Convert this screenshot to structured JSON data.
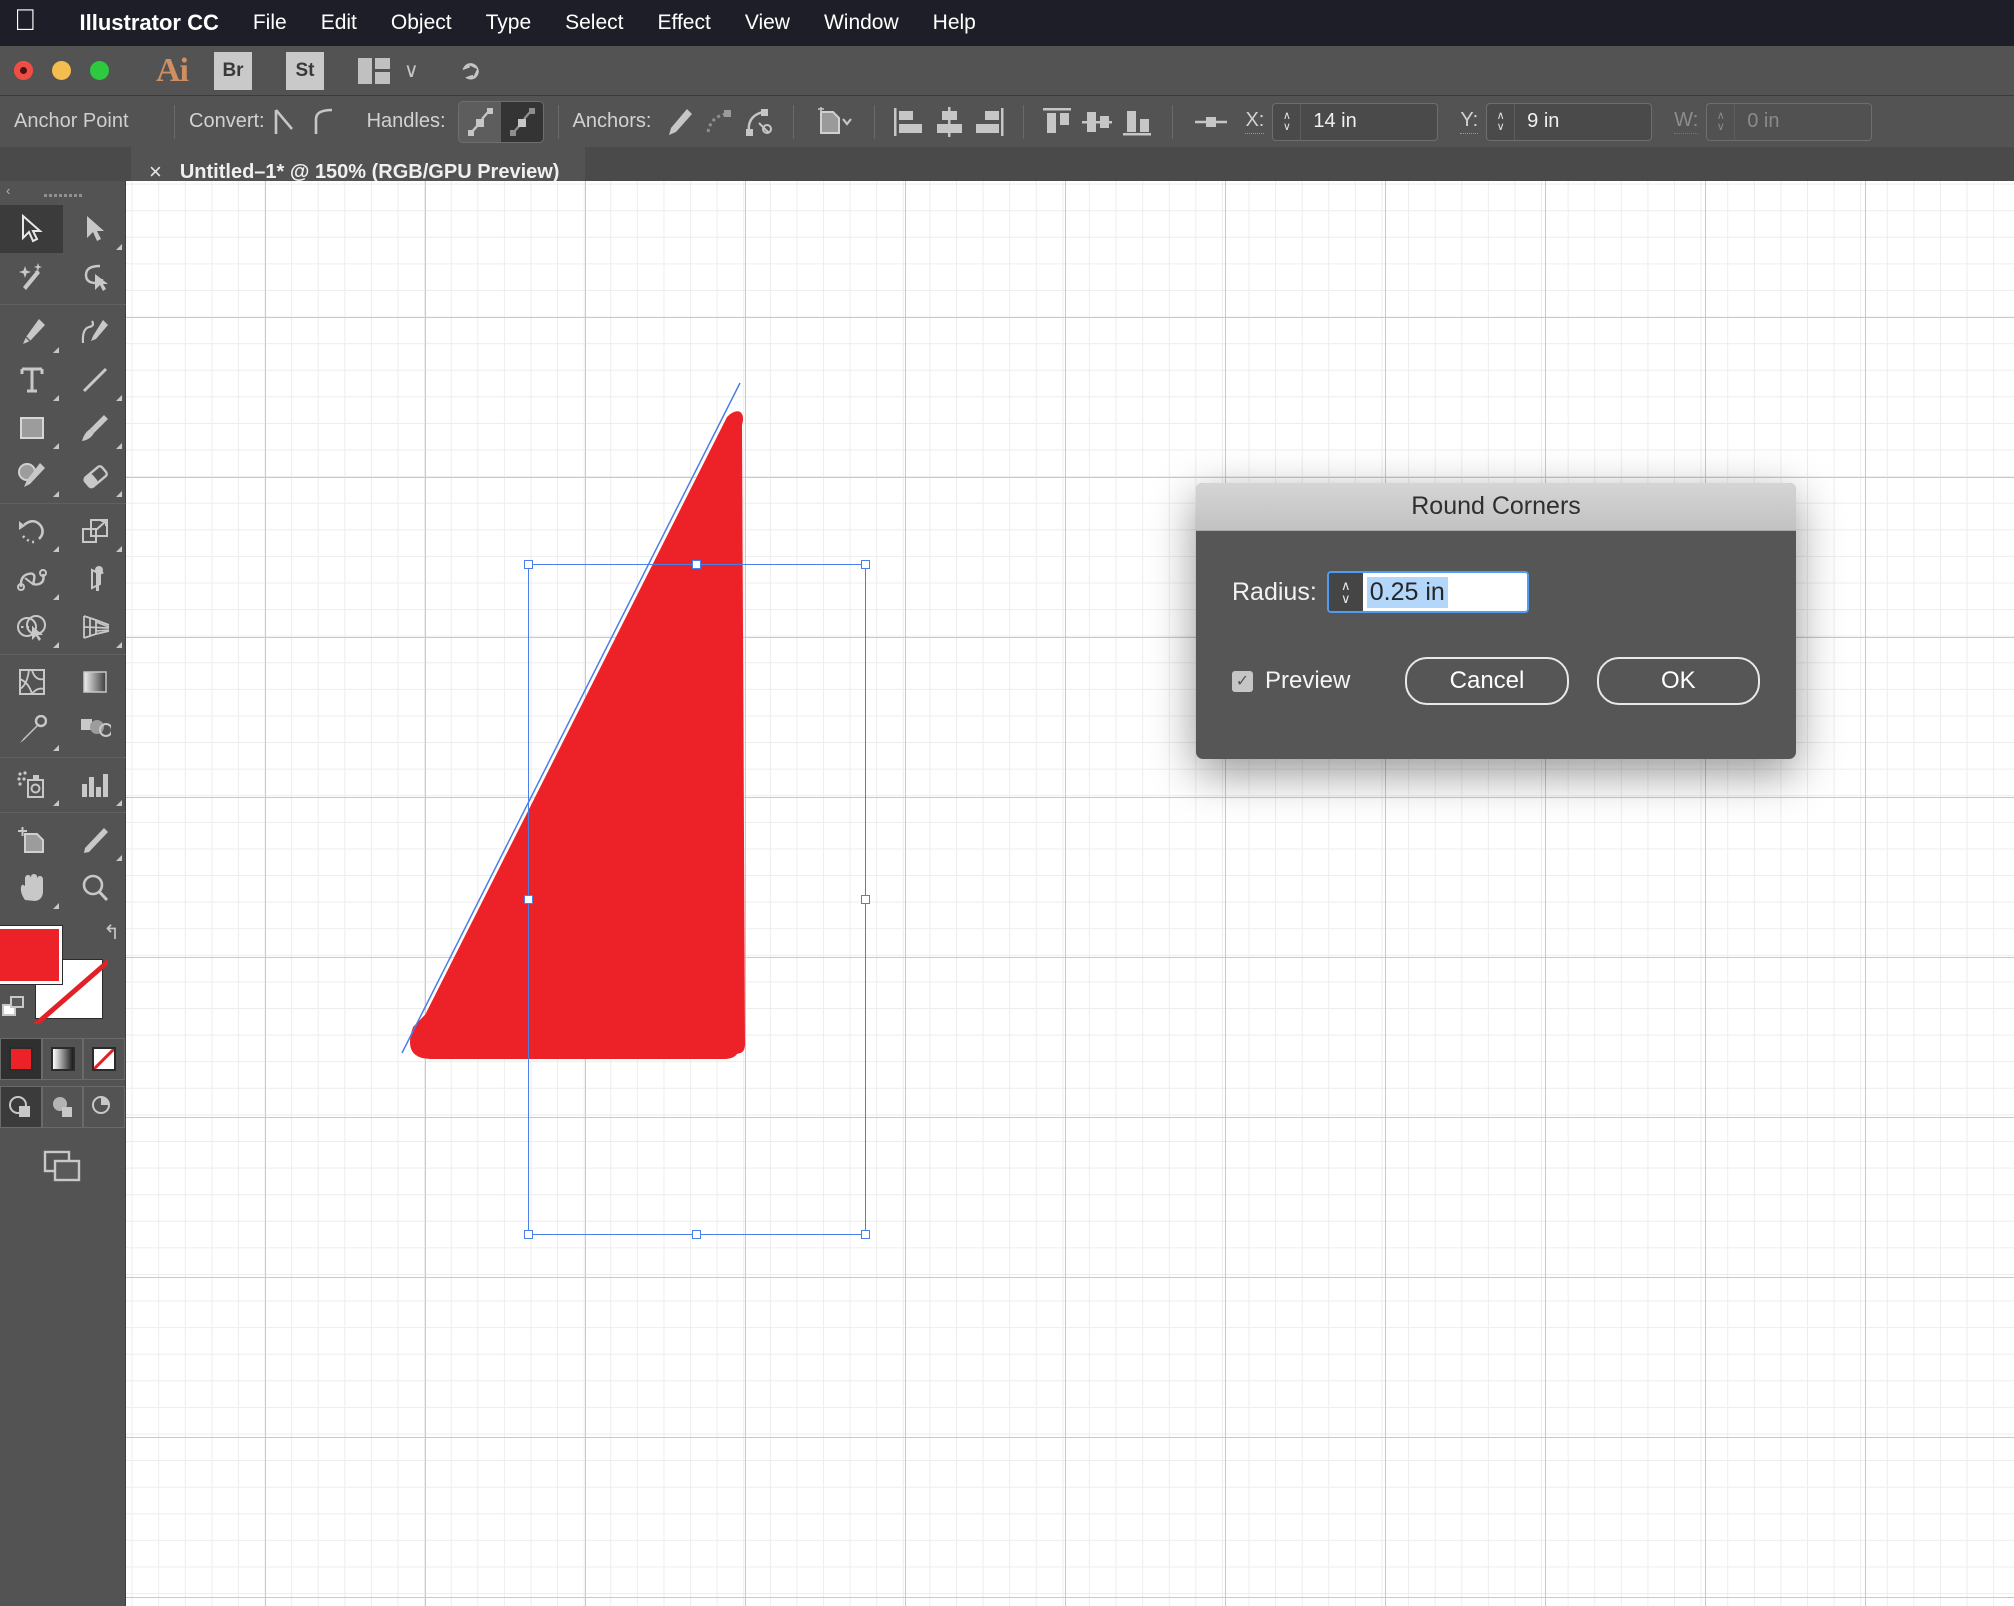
{
  "menubar": {
    "apple_icon": "apple-logo",
    "items": [
      {
        "label": "Illustrator CC",
        "bold": true
      },
      {
        "label": "File",
        "bold": false
      },
      {
        "label": "Edit",
        "bold": false
      },
      {
        "label": "Object",
        "bold": false
      },
      {
        "label": "Type",
        "bold": false
      },
      {
        "label": "Select",
        "bold": false
      },
      {
        "label": "Effect",
        "bold": false
      },
      {
        "label": "View",
        "bold": false
      },
      {
        "label": "Window",
        "bold": false
      },
      {
        "label": "Help",
        "bold": false
      }
    ]
  },
  "apptoolbar": {
    "app_logo": "Ai",
    "bridge_label": "Br",
    "stock_label": "St",
    "workspace_icon": "workspace-switcher-icon",
    "chevron": "∨",
    "rocket_icon": "rocket-icon"
  },
  "controlbar": {
    "context_label": "Anchor Point",
    "convert_label": "Convert:",
    "handles_label": "Handles:",
    "anchors_label": "Anchors:",
    "x_label": "X:",
    "x_value": "14 in",
    "y_label": "Y:",
    "y_value": "9 in",
    "w_label": "W:",
    "w_value": "0 in",
    "stepper_up": "∧",
    "stepper_down": "∨"
  },
  "tabbar": {
    "close_glyph": "×",
    "title": "Untitled–1* @ 150% (RGB/GPU Preview)"
  },
  "toolpanel": {
    "collapse_glyph": "‹",
    "tools": [
      {
        "name": "selection-tool",
        "active": true
      },
      {
        "name": "direct-selection-tool",
        "active": false
      },
      {
        "name": "magic-wand-tool",
        "active": false
      },
      {
        "name": "lasso-tool",
        "active": false
      },
      {
        "name": "pen-tool",
        "active": false
      },
      {
        "name": "curvature-tool",
        "active": false
      },
      {
        "name": "type-tool",
        "active": false
      },
      {
        "name": "line-segment-tool",
        "active": false
      },
      {
        "name": "rectangle-tool",
        "active": false
      },
      {
        "name": "paintbrush-tool",
        "active": false
      },
      {
        "name": "shaper-pencil-tool",
        "active": false
      },
      {
        "name": "eraser-tool",
        "active": false
      },
      {
        "name": "rotate-tool",
        "active": false
      },
      {
        "name": "scale-tool",
        "active": false
      },
      {
        "name": "width-tool",
        "active": false
      },
      {
        "name": "free-transform-tool",
        "active": false
      },
      {
        "name": "shape-builder-tool",
        "active": false
      },
      {
        "name": "perspective-grid-tool",
        "active": false
      },
      {
        "name": "mesh-tool",
        "active": false
      },
      {
        "name": "gradient-tool",
        "active": false
      },
      {
        "name": "eyedropper-tool",
        "active": false
      },
      {
        "name": "blend-tool",
        "active": false
      },
      {
        "name": "symbol-sprayer-tool",
        "active": false
      },
      {
        "name": "column-graph-tool",
        "active": false
      },
      {
        "name": "artboard-tool",
        "active": false
      },
      {
        "name": "slice-tool",
        "active": false
      },
      {
        "name": "hand-tool",
        "active": false
      },
      {
        "name": "zoom-tool",
        "active": false
      }
    ],
    "fill_color": "#ed2228",
    "stroke_color": "none",
    "swap_glyph": "↰"
  },
  "canvas": {
    "grid_minor_color": "#ededed",
    "grid_major_color": "#c9c9c9",
    "background": "#ffffff",
    "selection_color": "#4a7fe8",
    "shape": {
      "name": "rounded-triangle",
      "fill": "#ed2128",
      "stroke": "#4a7fe8"
    }
  },
  "dialog": {
    "title": "Round Corners",
    "radius_label": "Radius:",
    "radius_value": "0.25 in",
    "stepper_up": "∧",
    "stepper_down": "∨",
    "preview_label": "Preview",
    "preview_checked": true,
    "check_glyph": "✓",
    "cancel_label": "Cancel",
    "ok_label": "OK"
  }
}
